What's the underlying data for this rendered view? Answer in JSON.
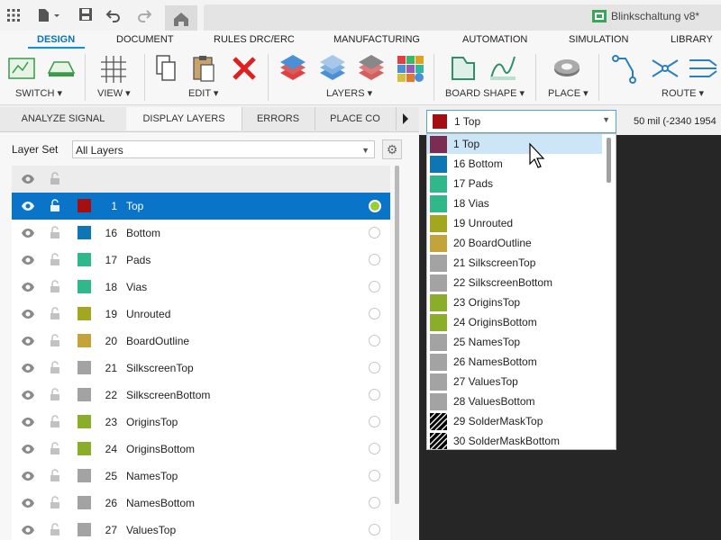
{
  "window": {
    "doc_title": "Blinkschaltung v8*"
  },
  "ribbon_tabs": [
    "DESIGN",
    "DOCUMENT",
    "RULES DRC/ERC",
    "MANUFACTURING",
    "AUTOMATION",
    "SIMULATION",
    "LIBRARY"
  ],
  "toolbar": {
    "switch": "SWITCH ▾",
    "view": "VIEW ▾",
    "edit": "EDIT ▾",
    "layers": "LAYERS ▾",
    "board_shape": "BOARD SHAPE ▾",
    "place": "PLACE ▾",
    "route": "ROUTE ▾"
  },
  "panel_tabs": [
    "ANALYZE SIGNAL",
    "DISPLAY LAYERS",
    "ERRORS",
    "PLACE CO"
  ],
  "layer_set": {
    "label": "Layer Set",
    "value": "All Layers"
  },
  "layers": [
    {
      "num": "1",
      "name": "Top",
      "color": "#a50f0f",
      "selected": true
    },
    {
      "num": "16",
      "name": "Bottom",
      "color": "#0e76b5"
    },
    {
      "num": "17",
      "name": "Pads",
      "color": "#2fb88a"
    },
    {
      "num": "18",
      "name": "Vias",
      "color": "#2fb88a"
    },
    {
      "num": "19",
      "name": "Unrouted",
      "color": "#a3a61f"
    },
    {
      "num": "20",
      "name": "BoardOutline",
      "color": "#c4a33a"
    },
    {
      "num": "21",
      "name": "SilkscreenTop",
      "color": "#a3a3a3"
    },
    {
      "num": "22",
      "name": "SilkscreenBottom",
      "color": "#a3a3a3"
    },
    {
      "num": "23",
      "name": "OriginsTop",
      "color": "#8aad2a"
    },
    {
      "num": "24",
      "name": "OriginsBottom",
      "color": "#8aad2a"
    },
    {
      "num": "25",
      "name": "NamesTop",
      "color": "#a3a3a3"
    },
    {
      "num": "26",
      "name": "NamesBottom",
      "color": "#a3a3a3"
    },
    {
      "num": "27",
      "name": "ValuesTop",
      "color": "#a3a3a3"
    }
  ],
  "layer_combo": {
    "value": "1 Top",
    "color": "#a50f0f"
  },
  "grid_readout": "50 mil (-2340 1954",
  "dropdown_items": [
    {
      "label": "1 Top",
      "color": "#7a2c52",
      "highlighted": true
    },
    {
      "label": "16 Bottom",
      "color": "#0e76b5"
    },
    {
      "label": "17 Pads",
      "color": "#2fb88a"
    },
    {
      "label": "18 Vias",
      "color": "#2fb88a"
    },
    {
      "label": "19 Unrouted",
      "color": "#a3a61f"
    },
    {
      "label": "20 BoardOutline",
      "color": "#c4a33a"
    },
    {
      "label": "21 SilkscreenTop",
      "color": "#a3a3a3"
    },
    {
      "label": "22 SilkscreenBottom",
      "color": "#a3a3a3"
    },
    {
      "label": "23 OriginsTop",
      "color": "#8aad2a"
    },
    {
      "label": "24 OriginsBottom",
      "color": "#8aad2a"
    },
    {
      "label": "25 NamesTop",
      "color": "#a3a3a3"
    },
    {
      "label": "26 NamesBottom",
      "color": "#a3a3a3"
    },
    {
      "label": "27 ValuesTop",
      "color": "#a3a3a3"
    },
    {
      "label": "28 ValuesBottom",
      "color": "#a3a3a3"
    },
    {
      "label": "29 SolderMaskTop",
      "color": "hatched"
    },
    {
      "label": "30 SolderMaskBottom",
      "color": "hatched"
    }
  ]
}
